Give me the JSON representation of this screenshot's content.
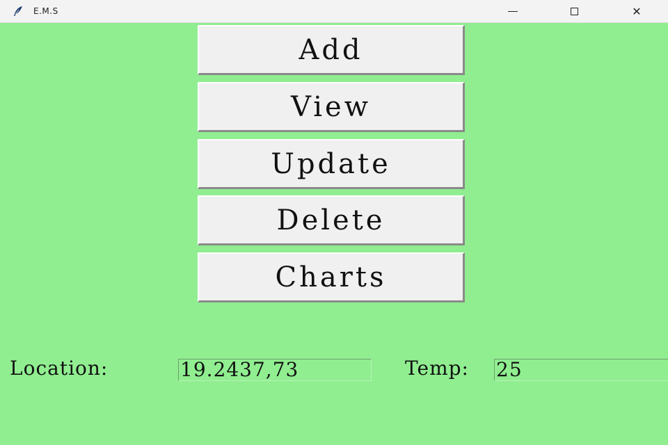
{
  "window": {
    "title": "E.M.S",
    "controls": {
      "minimize_icon": "minimize-icon",
      "maximize_icon": "maximize-icon",
      "close_icon": "close-icon",
      "close_glyph": "✕"
    },
    "background_color": "#90ee90"
  },
  "menu": {
    "add_label": "Add",
    "view_label": "View",
    "update_label": "Update",
    "delete_label": "Delete",
    "charts_label": "Charts"
  },
  "info": {
    "location_label": "Location:",
    "location_value": "19.2437,73",
    "temp_label": "Temp:",
    "temp_value": "25"
  }
}
